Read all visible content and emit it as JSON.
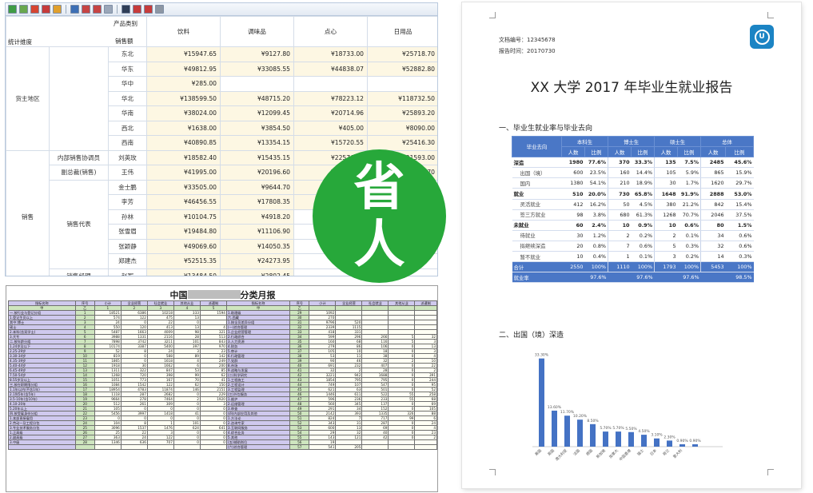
{
  "pivot": {
    "corner_col_label": "产品类别",
    "corner_row_label": "统计维度",
    "corner_sub_label": "销售额",
    "columns": [
      "饮料",
      "调味品",
      "点心",
      "日用品"
    ],
    "rows": [
      {
        "g1": "货主地区",
        "g2": "",
        "name": "东北",
        "v": [
          "¥15947.65",
          "¥9127.80",
          "¥18733.00",
          "¥25718.70"
        ]
      },
      {
        "g1": "",
        "g2": "",
        "name": "华东",
        "v": [
          "¥49812.95",
          "¥33085.55",
          "¥44838.07",
          "¥52882.80"
        ]
      },
      {
        "g1": "",
        "g2": "",
        "name": "华中",
        "v": [
          "¥285.00",
          "",
          "",
          ""
        ]
      },
      {
        "g1": "",
        "g2": "",
        "name": "华北",
        "v": [
          "¥138599.50",
          "¥48715.20",
          "¥78223.12",
          "¥118732.50"
        ]
      },
      {
        "g1": "",
        "g2": "",
        "name": "华南",
        "v": [
          "¥38024.00",
          "¥12099.45",
          "¥20714.96",
          "¥25893.20"
        ]
      },
      {
        "g1": "",
        "g2": "",
        "name": "西北",
        "v": [
          "¥1638.00",
          "¥3854.50",
          "¥405.00",
          "¥8090.00"
        ]
      },
      {
        "g1": "",
        "g2": "",
        "name": "西南",
        "v": [
          "¥40890.85",
          "¥13354.15",
          "¥15720.55",
          "¥25416.30"
        ]
      },
      {
        "g1": "销售",
        "g2": "内部销售协调员",
        "name": "刘英玫",
        "v": [
          "¥18582.40",
          "¥15435.15",
          "¥22576.50",
          "¥21593.00"
        ]
      },
      {
        "g1": "",
        "g2": "副总裁(销售)",
        "name": "王伟",
        "v": [
          "¥41995.00",
          "¥20196.60",
          "¥21688.15",
          "¥29424.70"
        ]
      },
      {
        "g1": "",
        "g2": "销售代表",
        "name": "金士鹏",
        "v": [
          "¥33505.00",
          "¥9644.70",
          "¥16754.45",
          ""
        ]
      },
      {
        "g1": "",
        "g2": "",
        "name": "李芳",
        "v": [
          "¥46456.55",
          "¥17808.35",
          "¥3568",
          ""
        ]
      },
      {
        "g1": "",
        "g2": "",
        "name": "孙林",
        "v": [
          "¥10104.75",
          "¥4918.20",
          "",
          ""
        ]
      },
      {
        "g1": "",
        "g2": "",
        "name": "张雪眉",
        "v": [
          "¥19484.80",
          "¥11106.90",
          "",
          ""
        ]
      },
      {
        "g1": "",
        "g2": "",
        "name": "张颖静",
        "v": [
          "¥49069.60",
          "¥14050.35",
          "",
          ""
        ]
      },
      {
        "g1": "",
        "g2": "",
        "name": "郑建杰",
        "v": [
          "¥52515.35",
          "¥24273.95",
          "",
          ""
        ]
      },
      {
        "g1": "",
        "g2": "销售经理",
        "name": "赵军",
        "v": [
          "¥13484.50",
          "¥2802.45",
          "",
          ""
        ]
      }
    ]
  },
  "sheet": {
    "title_left": "中国",
    "title_right": "分类月报",
    "head_left": [
      "指标名称",
      "序号",
      "小计",
      "全业经营",
      "社会就业",
      "其他从业",
      "派遣制"
    ],
    "head_right": [
      "指标名称",
      "序号",
      "小计",
      "全业经营",
      "社会就业",
      "其他从业",
      "派遣制"
    ],
    "sub_left": [
      "甲",
      "乙",
      "1",
      "2",
      "3",
      "4",
      "5"
    ],
    "sub_right": [
      "甲",
      "乙",
      "",
      "",
      "",
      "",
      ""
    ],
    "rows": [
      [
        "一.按行业与登记分组",
        "1",
        "18521",
        "6386",
        "10218",
        "333",
        "1594",
        "1.助理级",
        "29",
        "1092",
        "",
        "",
        "",
        ""
      ],
      [
        "1.登记生员以上",
        "2",
        "574",
        "122",
        "475",
        "13",
        "",
        "六.西藏",
        "30",
        "270",
        "",
        "",
        "",
        ""
      ],
      [
        "其中:博士",
        "3",
        "24",
        "0",
        "22",
        "0",
        "",
        "1.按全员差异分组",
        "31",
        "9796",
        "520",
        "",
        "",
        ""
      ],
      [
        "硕士",
        "4",
        "550",
        "120",
        "413",
        "13",
        "4",
        "(一)综合管理",
        "32",
        "2339",
        "1115",
        "",
        "",
        ""
      ],
      [
        "2.本科(含双学士)",
        "5",
        "5487",
        "1663",
        "4009",
        "98",
        "321",
        "1.企业经营管理",
        "33",
        "418",
        "331",
        "",
        "",
        ""
      ],
      [
        "3.大专",
        "6",
        "3988",
        "1331",
        "2116",
        "28",
        "513",
        "2.行政综合",
        "34",
        "599",
        "296",
        "266",
        "5",
        "32"
      ],
      [
        "二.按年龄分组",
        "7",
        "7898",
        "3742",
        "3211",
        "101",
        "843",
        "3.人力资源",
        "35",
        "160",
        "68",
        "116",
        "5",
        "3"
      ],
      [
        "1.24岁及以下",
        "8",
        "10174",
        "3387",
        "5400",
        "397",
        "970",
        "4.财务",
        "36",
        "279",
        "86",
        "106",
        "0",
        "13"
      ],
      [
        "2.25-29岁",
        "9",
        "52",
        "8",
        "24",
        "3",
        "23",
        "5.审计",
        "37",
        "105",
        "10",
        "18",
        "0",
        "3"
      ],
      [
        "3.30-34岁",
        "10",
        "819",
        "0",
        "588",
        "89",
        "142",
        "6.行政管理",
        "38",
        "53",
        "11",
        "38",
        "0",
        "4"
      ],
      [
        "4.35-39岁",
        "11",
        "1865",
        "0",
        "1618",
        "4",
        "249",
        "7.党群",
        "39",
        "90",
        "46",
        "32",
        "2",
        "10"
      ],
      [
        "5.40-44岁",
        "12",
        "1918",
        "30",
        "1662",
        "6",
        "200",
        "8.市场",
        "40",
        "691",
        "232",
        "407",
        "0",
        "22"
      ],
      [
        "6.45-49岁",
        "13",
        "1311",
        "322",
        "847",
        "53",
        "85",
        "9.战略与发展",
        "41",
        "32",
        "2",
        "28",
        "0",
        "2"
      ],
      [
        "7.50-54岁",
        "14",
        "1268",
        "720",
        "398",
        "99",
        "62",
        "(二)科学研究",
        "42",
        "3221",
        "942",
        "1688",
        "0",
        "391"
      ],
      [
        "8.55岁及以上",
        "15",
        "1051",
        "773",
        "167",
        "70",
        "41",
        "1.工程施工",
        "43",
        "1854",
        "795",
        "795",
        "0",
        "244"
      ],
      [
        "三.按在职期限分组",
        "16",
        "1084",
        "1542",
        "122",
        "62",
        "150",
        "2.工程设计",
        "44",
        "749",
        "107",
        "547",
        "0",
        "95"
      ],
      [
        "1.1年以内(不含1年)",
        "17",
        "18954",
        "4783",
        "11874",
        "146",
        "2151",
        "3.工程监理",
        "45",
        "621",
        "63",
        "501",
        "0",
        "52"
      ],
      [
        "2.1到5年(含5年)",
        "18",
        "1118",
        "287",
        "2682",
        "0",
        "229",
        "(三)外包服务",
        "46",
        "1446",
        "611",
        "522",
        "55",
        "258"
      ],
      [
        "3.5-10年(含10年)",
        "19",
        "9664",
        "278",
        "7464",
        "2",
        "1920",
        "1.维护",
        "47",
        "596",
        "236",
        "233",
        "55",
        "68"
      ],
      [
        "4.10-20年",
        "20",
        "512",
        "261",
        "309",
        "0",
        "3",
        "2.运维管理",
        "48",
        "560",
        "345",
        "137",
        "0",
        "69"
      ],
      [
        "5.20年以上",
        "21",
        "105",
        "0",
        "0",
        "0",
        "0",
        "3.审查",
        "49",
        "291",
        "34",
        "152",
        "0",
        "105"
      ],
      [
        "四.按受雇身份分组",
        "22",
        "5456",
        "3997",
        "1418",
        "41",
        "0",
        "(四)内部应用及其他",
        "50",
        "2142",
        "393",
        "1335",
        "326",
        "88"
      ],
      [
        "1.本部直接雇用",
        "23",
        "0",
        "0",
        "0",
        "0",
        "0",
        "1.方法论",
        "51",
        "824",
        "7",
        "717",
        "99",
        "6"
      ],
      [
        "2.劳动一及工程分包",
        "24",
        "104",
        "8",
        "1",
        "101",
        "0",
        "2.咨询专家",
        "52",
        "343",
        "31",
        "287",
        "0",
        "24"
      ],
      [
        "3.专业技术服务分包",
        "25",
        "3096",
        "1537",
        "1476",
        "624",
        "641",
        "3.互联网服务",
        "53",
        "600",
        "13",
        "69",
        "0",
        "4"
      ],
      [
        "1.正高级",
        "26",
        "25",
        "22",
        "3",
        "0",
        "0",
        "4.综合业务",
        "54",
        "29",
        "32",
        "40",
        "0",
        "23"
      ],
      [
        "2.副高级",
        "27",
        "363",
        "24",
        "122",
        "0",
        "0",
        "5.其他",
        "55",
        "143",
        "121",
        "42",
        "0",
        "2"
      ],
      [
        "3.中级",
        "28",
        "1346",
        "636",
        "707",
        "0",
        "0",
        "(五)辅助岗位",
        "56",
        "19",
        "",
        "",
        "",
        ""
      ],
      [
        "",
        "",
        "",
        "",
        "",
        "",
        "",
        "(六)综合管理",
        "57",
        "541",
        "205",
        "",
        "",
        ""
      ]
    ]
  },
  "doc": {
    "doc_no_label": "文档编号：",
    "doc_no": "12345678",
    "report_time_label": "报告时间：",
    "report_time": "20170730",
    "logo_glyph": "U",
    "title": "XX 大学 2017 年毕业生就业报告",
    "section1": "一、毕业生就业率与毕业去向",
    "section2": "二、出国（境）深造",
    "table": {
      "corner": "毕业去向",
      "groups": [
        "本科生",
        "博士生",
        "硕士生",
        "总体"
      ],
      "sub": [
        "人数",
        "比例"
      ],
      "rows": [
        {
          "label": "深造",
          "kind": "grp",
          "v": [
            "1980",
            "77.6%",
            "370",
            "33.3%",
            "135",
            "7.5%",
            "2485",
            "45.6%"
          ]
        },
        {
          "label": "出国（境）",
          "kind": "sub",
          "v": [
            "600",
            "23.5%",
            "160",
            "14.4%",
            "105",
            "5.9%",
            "865",
            "15.9%"
          ]
        },
        {
          "label": "国内",
          "kind": "sub",
          "v": [
            "1380",
            "54.1%",
            "210",
            "18.9%",
            "30",
            "1.7%",
            "1620",
            "29.7%"
          ]
        },
        {
          "label": "就业",
          "kind": "grp",
          "v": [
            "510",
            "20.0%",
            "730",
            "65.8%",
            "1648",
            "91.9%",
            "2888",
            "53.0%"
          ]
        },
        {
          "label": "灵活就业",
          "kind": "sub",
          "v": [
            "412",
            "16.2%",
            "50",
            "4.5%",
            "380",
            "21.2%",
            "842",
            "15.4%"
          ]
        },
        {
          "label": "签三方就业",
          "kind": "sub",
          "v": [
            "98",
            "3.8%",
            "680",
            "61.3%",
            "1268",
            "70.7%",
            "2046",
            "37.5%"
          ]
        },
        {
          "label": "未就业",
          "kind": "grp",
          "v": [
            "60",
            "2.4%",
            "10",
            "0.9%",
            "10",
            "0.6%",
            "80",
            "1.5%"
          ]
        },
        {
          "label": "待就业",
          "kind": "sub",
          "v": [
            "30",
            "1.2%",
            "2",
            "0.2%",
            "2",
            "0.1%",
            "34",
            "0.6%"
          ]
        },
        {
          "label": "拟继续深造",
          "kind": "sub",
          "v": [
            "20",
            "0.8%",
            "7",
            "0.6%",
            "5",
            "0.3%",
            "32",
            "0.6%"
          ]
        },
        {
          "label": "暂不就业",
          "kind": "sub",
          "v": [
            "10",
            "0.4%",
            "1",
            "0.1%",
            "3",
            "0.2%",
            "14",
            "0.3%"
          ]
        },
        {
          "label": "合计",
          "kind": "tot",
          "v": [
            "2550",
            "100%",
            "1110",
            "100%",
            "1793",
            "100%",
            "5453",
            "100%"
          ]
        }
      ],
      "rate_label": "就业率",
      "rate_values": [
        "97.6%",
        "97.6%",
        "97.6%",
        "98.5%"
      ]
    }
  },
  "badge": {
    "line1": "省",
    "line2": "人",
    "color": "#27a83a"
  },
  "chart_data": {
    "type": "bar",
    "title": "",
    "xlabel": "",
    "ylabel": "",
    "categories": [
      "美国",
      "英国",
      "澳大利亚",
      "法国",
      "德国",
      "新加坡",
      "加拿大",
      "中国香港",
      "瑞士",
      "日本",
      "荷兰",
      "意大利"
    ],
    "values": [
      33.3,
      13.6,
      11.7,
      10.2,
      8.5,
      5.7,
      5.7,
      5.5,
      4.5,
      3.1,
      2.3,
      0.9,
      0.9
    ],
    "series": [
      {
        "values": [
          33.3,
          13.6,
          11.7,
          10.2,
          8.5,
          5.7,
          5.7,
          5.5,
          4.5,
          3.1,
          2.3,
          0.9,
          0.9
        ]
      }
    ],
    "data_labels": [
      "33.30%",
      "13.60%",
      "11.70%",
      "10.20%",
      "8.50%",
      "5.70%",
      "5.70%",
      "5.50%",
      "4.50%",
      "3.10%",
      "2.30%",
      "0.90%",
      "0.90%"
    ],
    "ylim": [
      0,
      35
    ],
    "grid": false,
    "bar_color": "#4472c4"
  }
}
